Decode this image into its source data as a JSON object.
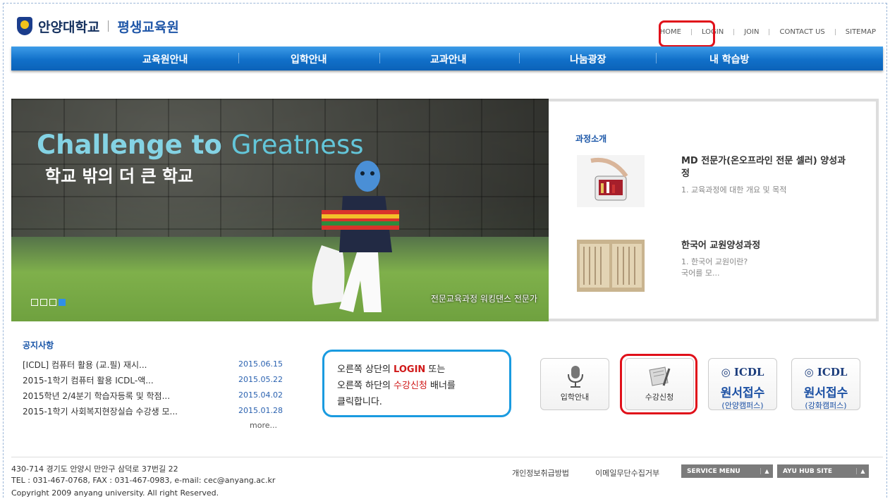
{
  "header": {
    "university": "안양대학교",
    "institute": "평생교육원",
    "top_links": [
      "HOME",
      "LOGIN",
      "JOIN",
      "CONTACT US",
      "SITEMAP"
    ]
  },
  "gnb": [
    "교육원안내",
    "입학안내",
    "교과안내",
    "나눔광장",
    "내 학습방"
  ],
  "hero": {
    "title_a": "Challenge to ",
    "title_b": "Greatness",
    "subtitle": "학교 밖의 더 큰 학교",
    "caption": "전문교육과정 워킹댄스 전문가"
  },
  "courses": {
    "heading": "과정소개",
    "items": [
      {
        "title": "MD 전문가(온오프라인 전문 셀러) 양성과정",
        "desc": "1. 교육과정에 대한 개요 및 목적"
      },
      {
        "title": "한국어 교원양성과정",
        "desc": "1. 한국어 교원이란?\n국어를 모..."
      }
    ]
  },
  "notices": {
    "heading": "공지사항",
    "items": [
      {
        "title": "[ICDL] 컴퓨터 활용 (교.필) 재시...",
        "date": "2015.06.15"
      },
      {
        "title": "2015-1학기 컴퓨터 활용 ICDL-액...",
        "date": "2015.05.22"
      },
      {
        "title": "2015학년 2/4분기 학습자등록 및 학점...",
        "date": "2015.04.02"
      },
      {
        "title": "2015-1학기 사회복지현장실습 수강생 모...",
        "date": "2015.01.28"
      }
    ],
    "more": "more..."
  },
  "callout": {
    "line1_a": "오른쪽 상단의 ",
    "line1_b": "LOGIN",
    "line1_c": " 또는",
    "line2_a": "오른쪽 하단의 ",
    "line2_b": "수강신청",
    "line2_c": " 배너를",
    "line3": "클릭합니다."
  },
  "banners": {
    "admission": "입학안내",
    "enroll": "수강신청",
    "icdl1": {
      "logo": "ICDL",
      "big": "원서접수",
      "small": "(안양캠퍼스)"
    },
    "icdl2": {
      "logo": "ICDL",
      "big": "원서접수",
      "small": "(강화캠퍼스)"
    }
  },
  "footer": {
    "address": "430-714 경기도 안양시 만안구 삼덕로 37번길 22",
    "contact": "TEL : 031-467-0768, FAX : 031-467-0983, e-mail: cec@anyang.ac.kr",
    "copyright": "Copyright 2009 anyang university. All right Reserved.",
    "privacy": "개인정보취급방법",
    "email_refuse": "이메일무단수집거부",
    "service_menu": "SERVICE MENU",
    "hub_site": "AYU HUB SITE"
  },
  "colors": {
    "primary": "#1170c9",
    "highlight": "#e0101a",
    "callout_border": "#1a9be0"
  }
}
